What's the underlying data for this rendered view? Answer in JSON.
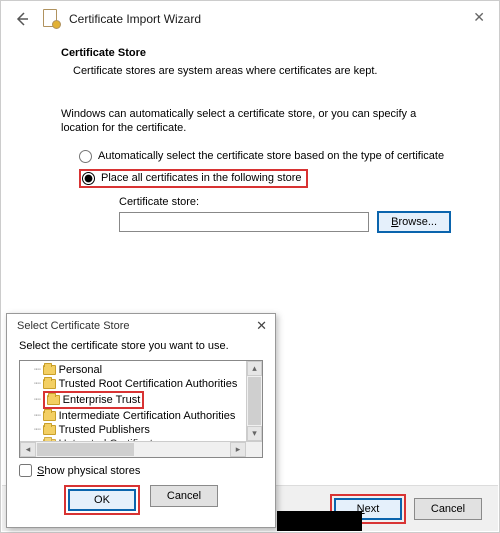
{
  "window": {
    "title": "Certificate Import Wizard"
  },
  "section": {
    "title": "Certificate Store",
    "desc": "Certificate stores are system areas where certificates are kept."
  },
  "help_text": "Windows can automatically select a certificate store, or you can specify a location for the certificate.",
  "radios": {
    "auto": "Automatically select the certificate store based on the type of certificate",
    "place": "Place all certificates in the following store"
  },
  "store": {
    "label": "Certificate store:",
    "value": "",
    "browse_prefix": "B",
    "browse_rest": "rowse..."
  },
  "footer": {
    "next_prefix": "N",
    "next_rest": "ext",
    "cancel": "Cancel"
  },
  "popup": {
    "title": "Select Certificate Store",
    "desc": "Select the certificate store you want to use.",
    "items": [
      "Personal",
      "Trusted Root Certification Authorities",
      "Enterprise Trust",
      "Intermediate Certification Authorities",
      "Trusted Publishers",
      "Untrusted Certificates"
    ],
    "show_physical_prefix": "S",
    "show_physical_rest": "how physical stores",
    "ok": "OK",
    "cancel": "Cancel"
  }
}
